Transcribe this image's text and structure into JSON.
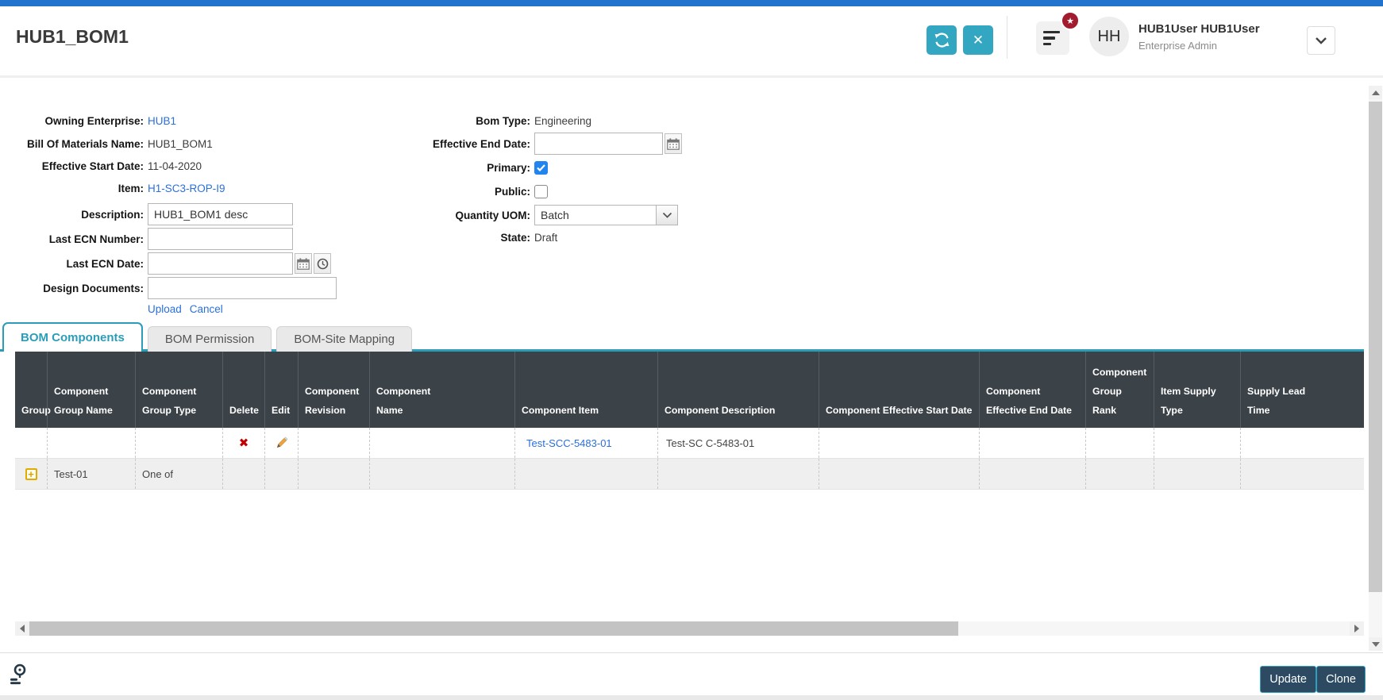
{
  "colors": {
    "top_bar_blue": "#2173cc",
    "accent_teal": "#33a6c2",
    "tab_teal": "#2b9db8",
    "table_header_bg": "#3b4248",
    "link_blue": "#2a6fdb",
    "badge_red": "#a21c30",
    "action_button_bg": "#2c4b63",
    "delete_red": "#c00000",
    "edit_pencil_orange": "#f2a33c",
    "group_expand_gold": "#e0ac00"
  },
  "icons": {
    "star": "★",
    "close": "✕",
    "delete": "✖",
    "plus": "+"
  },
  "header": {
    "title": "HUB1_BOM1",
    "user": {
      "name": "HUB1User HUB1User",
      "role": "Enterprise Admin",
      "initials": "HH"
    }
  },
  "form": {
    "owning_enterprise_label": "Owning Enterprise:",
    "owning_enterprise_value": "HUB1",
    "bom_name_label": "Bill Of Materials Name:",
    "bom_name_value": "HUB1_BOM1",
    "effective_start_label": "Effective Start Date:",
    "effective_start_value": "11-04-2020",
    "item_label": "Item:",
    "item_value": "H1-SC3-ROP-I9",
    "description_label": "Description:",
    "description_value": "HUB1_BOM1 desc",
    "last_ecn_number_label": "Last ECN Number:",
    "last_ecn_number_value": "",
    "last_ecn_date_label": "Last ECN Date:",
    "last_ecn_date_value": "",
    "design_documents_label": "Design Documents:",
    "design_documents_value": "",
    "upload_link": "Upload",
    "cancel_link": "Cancel",
    "bom_type_label": "Bom Type:",
    "bom_type_value": "Engineering",
    "effective_end_label": "Effective End Date:",
    "effective_end_value": "",
    "primary_label": "Primary:",
    "primary_checked": true,
    "public_label": "Public:",
    "public_checked": false,
    "quantity_uom_label": "Quantity UOM:",
    "quantity_uom_value": "Batch",
    "state_label": "State:",
    "state_value": "Draft"
  },
  "tabs": [
    "BOM Components",
    "BOM Permission",
    "BOM-Site Mapping"
  ],
  "table": {
    "columns": [
      "Group",
      "Component Group Name",
      "Component Group Type",
      "Delete",
      "Edit",
      "Component Revision",
      "Component Name",
      "Component Item",
      "Component Description",
      "Component Effective Start Date",
      "Component Effective End Date",
      "Component Group Rank",
      "Item Supply Type",
      "Supply Lead Time"
    ],
    "rows": [
      {
        "component_item": "Test-SCC-5483-01",
        "component_description": "Test-SC C-5483-01",
        "has_delete": true,
        "has_edit": true
      },
      {
        "component_group_name": "Test-01",
        "component_group_type": "One of",
        "has_expand": true
      }
    ]
  },
  "footer": {
    "update_label": "Update",
    "clone_label": "Clone"
  }
}
